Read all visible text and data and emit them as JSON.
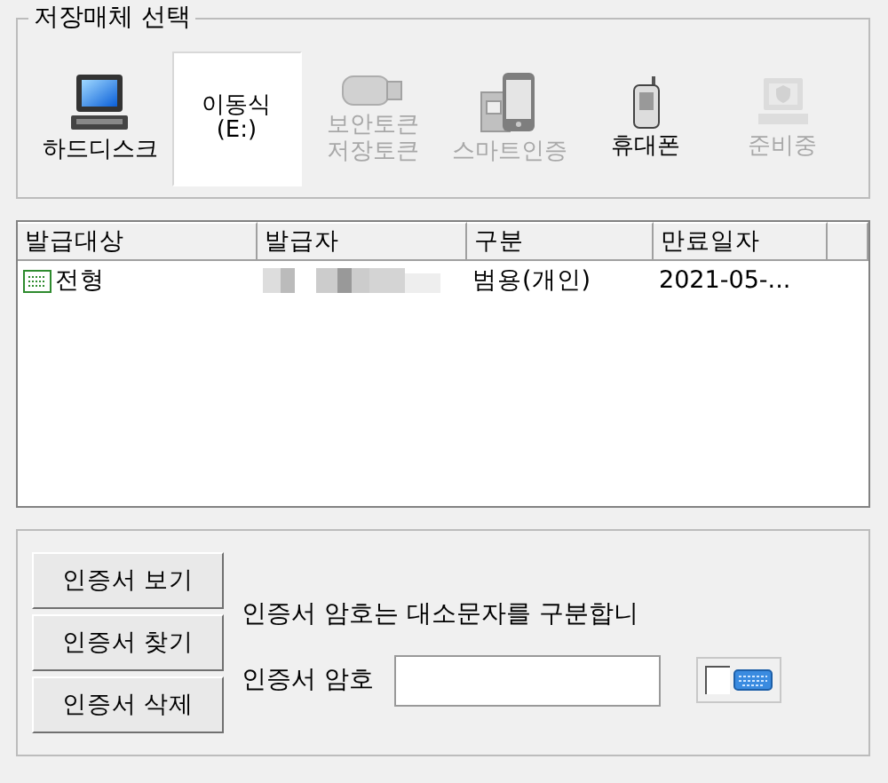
{
  "storage_group": {
    "title": "저장매체 선택",
    "media": [
      {
        "kind": "harddisk",
        "label": "하드디스크",
        "selected": false,
        "disabled": false
      },
      {
        "kind": "removable",
        "label": "이동식\n(E:)",
        "selected": true,
        "disabled": false
      },
      {
        "kind": "token",
        "label": "보안토큰\n저장토큰",
        "selected": false,
        "disabled": true
      },
      {
        "kind": "smartphone",
        "label": "스마트인증",
        "selected": false,
        "disabled": true
      },
      {
        "kind": "phone",
        "label": "휴대폰",
        "selected": false,
        "disabled": false
      },
      {
        "kind": "pending",
        "label": "준비중",
        "selected": false,
        "disabled": true
      }
    ]
  },
  "certificate_table": {
    "columns": [
      "발급대상",
      "발급자",
      "구분",
      "만료일자"
    ],
    "rows": [
      {
        "subject": "전형",
        "issuer_redacted": true,
        "type": "범용(개인)",
        "expires": "2021-05-..."
      }
    ]
  },
  "actions": {
    "buttons": [
      "인증서 보기",
      "인증서 찾기",
      "인증서 삭제"
    ],
    "notice": "인증서 암호는 대소문자를 구분합니",
    "password": {
      "label": "인증서 암호"
    },
    "secure_keyboard": {
      "checked": false
    }
  }
}
